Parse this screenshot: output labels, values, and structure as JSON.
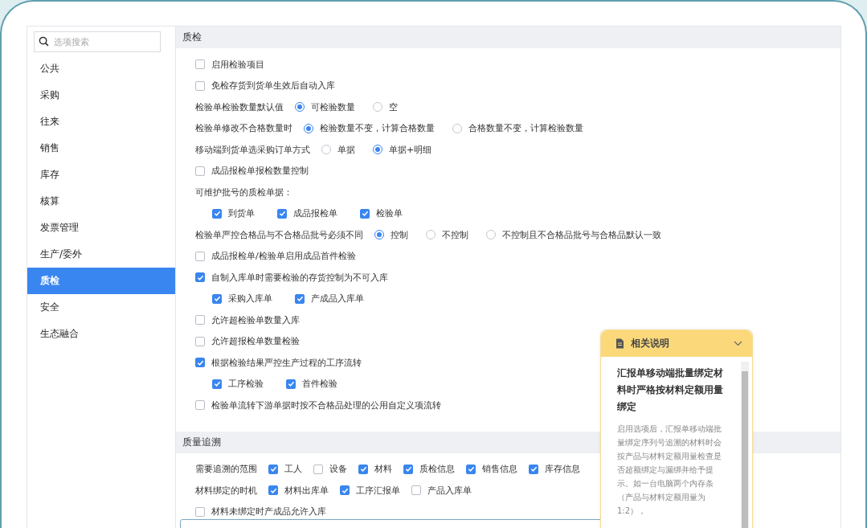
{
  "sidebar": {
    "search": {
      "placeholder": "选项搜索"
    },
    "items": [
      {
        "label": "公共",
        "selected": false
      },
      {
        "label": "采购",
        "selected": false
      },
      {
        "label": "往来",
        "selected": false
      },
      {
        "label": "销售",
        "selected": false
      },
      {
        "label": "库存",
        "selected": false
      },
      {
        "label": "核算",
        "selected": false
      },
      {
        "label": "发票管理",
        "selected": false
      },
      {
        "label": "生产/委外",
        "selected": false
      },
      {
        "label": "质检",
        "selected": true
      },
      {
        "label": "安全",
        "selected": false
      },
      {
        "label": "生态融合",
        "selected": false
      }
    ]
  },
  "sections": [
    {
      "title": "质检",
      "rows": [
        {
          "kind": "checkbox",
          "label": "启用检验项目",
          "checked": false
        },
        {
          "kind": "checkbox",
          "label": "免检存货到货单生效后自动入库",
          "checked": false
        },
        {
          "kind": "radio",
          "label": "检验单检验数量默认值",
          "options": [
            {
              "label": "可检验数量",
              "selected": true
            },
            {
              "label": "空",
              "selected": false
            }
          ]
        },
        {
          "kind": "radio",
          "label": "检验单修改不合格数量时",
          "options": [
            {
              "label": "检验数量不变，计算合格数量",
              "selected": true
            },
            {
              "label": "合格数量不变，计算检验数量",
              "selected": false
            }
          ]
        },
        {
          "kind": "radio",
          "label": "移动端到货单选采购订单方式",
          "options": [
            {
              "label": "单据",
              "selected": false
            },
            {
              "label": "单据+明细",
              "selected": true
            }
          ]
        },
        {
          "kind": "checkbox",
          "label": "成品报检单报检数量控制",
          "checked": false
        },
        {
          "kind": "heading",
          "label": "可维护批号的质检单据："
        },
        {
          "kind": "checkgroup",
          "options": [
            {
              "label": "到货单",
              "checked": true
            },
            {
              "label": "成品报检单",
              "checked": true
            },
            {
              "label": "检验单",
              "checked": true
            }
          ]
        },
        {
          "kind": "radio",
          "label": "检验单严控合格品与不合格品批号必须不同",
          "options": [
            {
              "label": "控制",
              "selected": true
            },
            {
              "label": "不控制",
              "selected": false
            },
            {
              "label": "不控制且不合格品批号与合格品默认一致",
              "selected": false
            }
          ]
        },
        {
          "kind": "checkbox",
          "label": "成品报检单/检验单启用成品首件检验",
          "checked": false
        },
        {
          "kind": "checkbox",
          "label": "自制入库单时需要检验的存货控制为不可入库",
          "checked": true
        },
        {
          "kind": "checkgroup",
          "options": [
            {
              "label": "采购入库单",
              "checked": true
            },
            {
              "label": "产成品入库单",
              "checked": true
            }
          ]
        },
        {
          "kind": "checkbox",
          "label": "允许超检验单数量入库",
          "checked": false
        },
        {
          "kind": "checkbox",
          "label": "允许超报检单数量检验",
          "checked": false
        },
        {
          "kind": "checkbox",
          "label": "根据检验结果严控生产过程的工序流转",
          "checked": true
        },
        {
          "kind": "checkgroup",
          "options": [
            {
              "label": "工序检验",
              "checked": true
            },
            {
              "label": "首件检验",
              "checked": true
            }
          ]
        },
        {
          "kind": "checkbox",
          "label": "检验单流转下游单据时按不合格品处理的公用自定义项流转",
          "checked": false
        }
      ]
    },
    {
      "title": "质量追溯",
      "rows": [
        {
          "kind": "checkgroup",
          "label": "需要追溯的范围",
          "options": [
            {
              "label": "工人",
              "checked": true
            },
            {
              "label": "设备",
              "checked": false
            },
            {
              "label": "材料",
              "checked": true
            },
            {
              "label": "质检信息",
              "checked": true
            },
            {
              "label": "销售信息",
              "checked": true
            },
            {
              "label": "库存信息",
              "checked": true
            }
          ]
        },
        {
          "kind": "checkgroup",
          "label": "材料绑定的时机",
          "options": [
            {
              "label": "材料出库单",
              "checked": true
            },
            {
              "label": "工序汇报单",
              "checked": true
            },
            {
              "label": "产品入库单",
              "checked": false
            }
          ]
        },
        {
          "kind": "checkbox",
          "label": "材料未绑定时产成品允许入库",
          "checked": false
        }
      ]
    }
  ],
  "help": {
    "title": "相关说明",
    "heading": "汇报单移动端批量绑定材料时严格按材料定额用量绑定",
    "body": "启用选项后，汇报单移动端批量绑定序列号追溯的材料时会按产品与材料定额用量检查是否超额绑定与漏绑并给予提示。如一台电脑两个内存条（产品与材料定额用量为1:2），"
  }
}
